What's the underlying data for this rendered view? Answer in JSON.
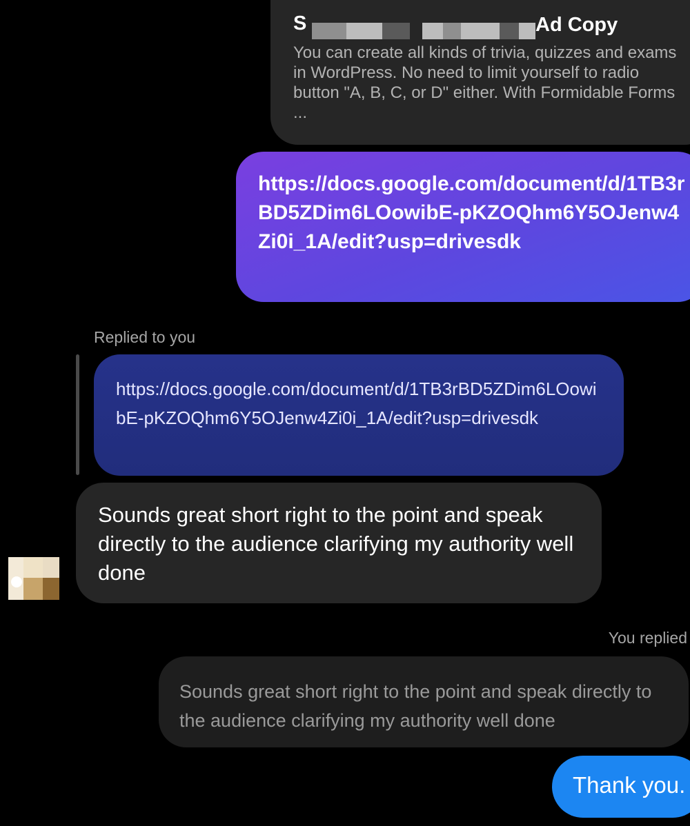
{
  "link_preview": {
    "title_start": "S",
    "title_end": "Ad Copy",
    "description": "You can create all kinds of trivia, quizzes and exams in WordPress. No need to limit yourself to radio button \"A, B, C, or D\" either. With Formidable Forms ..."
  },
  "sent_link": {
    "text": "https://docs.google.com/document/d/1TB3rBD5ZDim6LOowibE-pKZOQhm6Y5OJenw4Zi0i_1A/edit?usp=drivesdk"
  },
  "reply_context": {
    "label": "Replied to you",
    "quoted_text": "https://docs.google.com/document/d/1TB3rBD5ZDim6LOowibE-pKZOQhm6Y5OJenw4Zi0i_1A/edit?usp=drivesdk"
  },
  "incoming_message": {
    "text": "Sounds great short right to the point and speak directly to the audience clarifying my authority well done"
  },
  "my_reply_context": {
    "label": "You replied",
    "quoted_text": "Sounds great short right to the point and speak directly to the audience clarifying my authority well done"
  },
  "outgoing_message": {
    "text": "Thank you."
  },
  "colors": {
    "background": "#000000",
    "incoming_bubble": "#262626",
    "sent_gradient_start": "#7a3fe0",
    "sent_gradient_end": "#4a55e6",
    "quoted_bubble": "#26328a",
    "outgoing_bubble": "#1c86f2",
    "meta_text": "#a6a6a6"
  }
}
